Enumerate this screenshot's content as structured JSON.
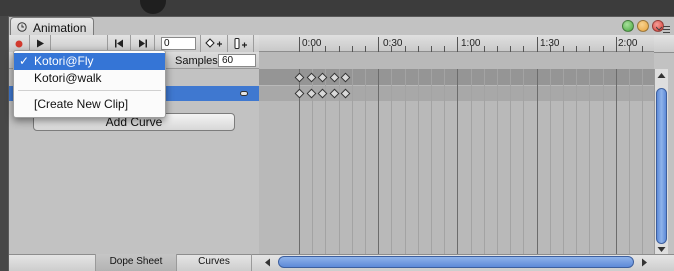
{
  "window": {
    "tab_label": "Animation"
  },
  "toolbar": {
    "frame_value": "0"
  },
  "ruler": {
    "labels": [
      "0:00",
      "0:30",
      "1:00",
      "1:30",
      "2:00"
    ]
  },
  "clip_row": {
    "samples_label": "Samples",
    "samples_value": "60"
  },
  "dropdown": {
    "items": [
      {
        "label": "Kotori@Fly",
        "selected": true
      },
      {
        "label": "Kotori@walk",
        "selected": false
      },
      {
        "label": "[Create New Clip]",
        "selected": false
      }
    ],
    "check": "✓"
  },
  "add_curve": {
    "label": "Add Curve"
  },
  "bottom_tabs": {
    "dope_sheet": "Dope Sheet",
    "curves": "Curves"
  },
  "colors": {
    "accent": "#3f78d0",
    "selection": "#3575d6",
    "close": "#d9382f",
    "minimize": "#e8a33a",
    "zoom": "#45a83c"
  }
}
